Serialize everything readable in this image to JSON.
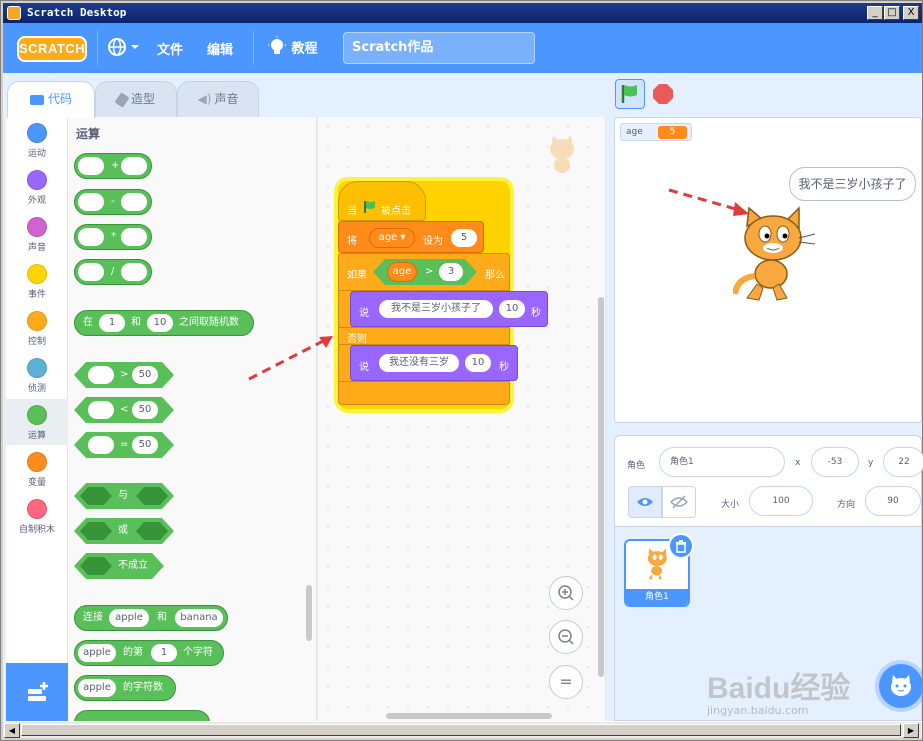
{
  "window": {
    "title": "Scratch Desktop",
    "min": "_",
    "max": "□",
    "close": "X"
  },
  "menubar": {
    "logo": "SCRATCH",
    "file": "文件",
    "edit": "编辑",
    "tutorials": "教程",
    "project_title": "Scratch作品"
  },
  "tabs": {
    "code": "代码",
    "costumes": "造型",
    "sounds": "声音"
  },
  "categories": [
    {
      "label": "运动",
      "color": "#4c97ff"
    },
    {
      "label": "外观",
      "color": "#9966ff"
    },
    {
      "label": "声音",
      "color": "#cf63cf"
    },
    {
      "label": "事件",
      "color": "#ffd500"
    },
    {
      "label": "控制",
      "color": "#ffab19"
    },
    {
      "label": "侦测",
      "color": "#5cb1d6"
    },
    {
      "label": "运算",
      "color": "#59c059"
    },
    {
      "label": "变量",
      "color": "#ff8c1a"
    },
    {
      "label": "自制积木",
      "color": "#ff6680"
    }
  ],
  "palette": {
    "title": "运算",
    "add": "+",
    "sub": "-",
    "mul": "*",
    "div": "/",
    "random": {
      "pre": "在",
      "a": "1",
      "mid": "和",
      "b": "10",
      "post": "之间取随机数"
    },
    "gt": {
      "op": ">",
      "val": "50"
    },
    "lt": {
      "op": "<",
      "val": "50"
    },
    "eq": {
      "op": "=",
      "val": "50"
    },
    "and": "与",
    "or": "或",
    "not": "不成立",
    "join": {
      "pre": "连接",
      "a": "apple",
      "mid": "和",
      "b": "banana"
    },
    "letter": {
      "a": "apple",
      "mid": "的第",
      "n": "1",
      "post": "个字符"
    },
    "length": {
      "a": "apple",
      "post": "的字符数"
    }
  },
  "script": {
    "hat_pre": "当",
    "hat_post": "被点击",
    "set_pre": "将",
    "set_var": "age",
    "set_mid": "设为",
    "set_val": "5",
    "if_label": "如果",
    "if_var": "age",
    "if_op": ">",
    "if_val": "3",
    "then_label": "那么",
    "say1": {
      "verb": "说",
      "text": "我不是三岁小孩子了",
      "secs": "10",
      "unit": "秒"
    },
    "else_label": "否则",
    "say2": {
      "verb": "说",
      "text": "我还没有三岁",
      "secs": "10",
      "unit": "秒"
    }
  },
  "zoom": {
    "in": "+",
    "out": "−",
    "reset": "="
  },
  "stage": {
    "monitor_label": "age",
    "monitor_value": "5",
    "speech": "我不是三岁小孩子了"
  },
  "sprite_info": {
    "sprite_label": "角色",
    "sprite_name": "角色1",
    "x_label": "x",
    "x": "-53",
    "y_label": "y",
    "y": "22",
    "size_label": "大小",
    "size": "100",
    "direction_label": "方向",
    "direction": "90"
  },
  "sprite_card": {
    "name": "角色1"
  },
  "watermark": {
    "brand": "Baidu经验",
    "url": "jingyan.baidu.com"
  },
  "colors": {
    "accent": "#4c97ff",
    "operators": "#59c059",
    "control": "#ffab19",
    "events": "#ffbf00",
    "looks": "#9966ff",
    "variables": "#ff8c1a"
  }
}
